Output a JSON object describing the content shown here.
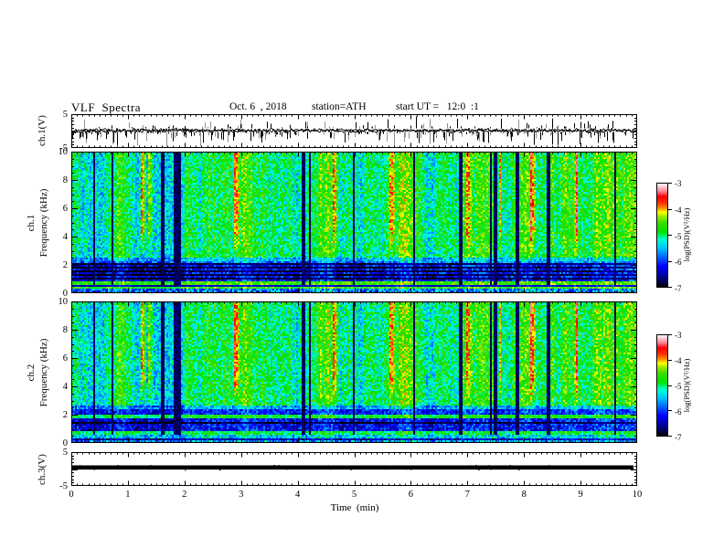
{
  "title": {
    "main": "VLF  Spectra",
    "date": "Oct. 6  , 2018",
    "station": "station=ATH",
    "start_ut": "start UT =   12:0  :1"
  },
  "axes": {
    "x": {
      "label": "Time  (min)",
      "min": 0,
      "max": 10,
      "major_ticks": [
        "0",
        "1",
        "2",
        "3",
        "4",
        "5",
        "6",
        "7",
        "8",
        "9",
        "10"
      ],
      "minor_step_min": 0.1
    },
    "wave1": {
      "ylabel": "ch.1(V)",
      "ticks": [
        "5",
        "-5"
      ],
      "ymin": -5,
      "ymax": 5
    },
    "spec1": {
      "ylabel_channel": "ch.1",
      "ylabel_axis": "Frequency  (kHz)",
      "ticks": [
        "10",
        "8",
        "6",
        "4",
        "2",
        "0"
      ],
      "ymin": 0,
      "ymax": 10
    },
    "spec2": {
      "ylabel_channel": "ch.2",
      "ylabel_axis": "Frequency  (kHz)",
      "ticks": [
        "10",
        "8",
        "6",
        "4",
        "2",
        "0"
      ],
      "ymin": 0,
      "ymax": 10
    },
    "wave3": {
      "ylabel": "ch.3(V)",
      "ticks": [
        "5",
        "-5"
      ],
      "ymin": -5,
      "ymax": 5
    }
  },
  "colorbar": {
    "label": "log(PSD)(V²/Hz)",
    "ticks": [
      "-3",
      "-4",
      "-5",
      "-6",
      "-7"
    ],
    "zmin": -7,
    "zmax": -3,
    "gradient_stops": [
      [
        0.0,
        "#000000"
      ],
      [
        0.09,
        "#000085"
      ],
      [
        0.2,
        "#0000ff"
      ],
      [
        0.3,
        "#0070ff"
      ],
      [
        0.38,
        "#00c8ff"
      ],
      [
        0.46,
        "#00ffd0"
      ],
      [
        0.53,
        "#00e400"
      ],
      [
        0.62,
        "#3cdc00"
      ],
      [
        0.68,
        "#9cec00"
      ],
      [
        0.72,
        "#ffff00"
      ],
      [
        0.76,
        "#ff8c00"
      ],
      [
        0.81,
        "#ff3000"
      ],
      [
        0.87,
        "#f80000"
      ],
      [
        0.92,
        "#ff8090"
      ],
      [
        0.97,
        "#ffd2dc"
      ],
      [
        1.0,
        "#ffffff"
      ]
    ]
  },
  "chart_data": [
    {
      "type": "line",
      "panel": "top-waveform",
      "ylabel": "ch.1(V)",
      "xlim": [
        0,
        10
      ],
      "ylim": [
        -5,
        5
      ],
      "yticks": [
        5,
        -5
      ],
      "description": "Continuous black VLF waveform, mean near 0 V with ~1 V broadband noise and dense impulsive sferic spikes reaching -5 to +5 V across the full 0-10 min record."
    },
    {
      "type": "heatmap",
      "panel": "ch1-spectrogram",
      "ylabel": "ch.1 Frequency (kHz)",
      "xlim": [
        0,
        10
      ],
      "ylim": [
        0,
        10
      ],
      "zlim": [
        -7,
        -3
      ],
      "zlabel": "log(PSD)(V²/Hz)",
      "yticks": [
        0,
        2,
        4,
        6,
        8,
        10
      ],
      "zticks": [
        -3,
        -4,
        -5,
        -6,
        -7
      ],
      "features": [
        "green broadband field near log PSD -5 covering 2.5-10 kHz",
        "dense vertical yellow/orange/red sferic striations spanning 3-10 kHz",
        "about 20 narrow black dropout columns through most of the band",
        "blue low-power region 0.9-2.5 kHz with dark horizontal stripes near 1.1, 1.35, 1.6, 1.85, 2.1 kHz",
        "bright green-yellow band 0.4-0.85 kHz with a dark line near 0.6 kHz",
        "dark speckled strip below 0.35 kHz"
      ]
    },
    {
      "type": "heatmap",
      "panel": "ch2-spectrogram",
      "ylabel": "ch.2 Frequency (kHz)",
      "xlim": [
        0,
        10
      ],
      "ylim": [
        0,
        10
      ],
      "zlim": [
        -7,
        -3
      ],
      "zlabel": "log(PSD)(V²/Hz)",
      "yticks": [
        0,
        2,
        4,
        6,
        8,
        10
      ],
      "zticks": [
        -3,
        -4,
        -5,
        -6,
        -7
      ],
      "features": [
        "green broadband field 2.6-10 kHz with yellow/orange/red striations",
        "black dropout columns at the same times as ch.1",
        "blue low-power region 0.95-2.6 kHz",
        "yellow-green horizontal band near 1.8-2.0 kHz",
        "green band 0.65-0.95 kHz",
        "banded dark/cyan speckle below 0.6 kHz"
      ]
    },
    {
      "type": "line",
      "panel": "bottom-waveform",
      "ylabel": "ch.3(V)",
      "xlim": [
        0,
        10
      ],
      "ylim": [
        -5,
        5
      ],
      "yticks": [
        5,
        -5
      ],
      "description": "Flat thick black trace pinned near +0.4 V for the entire record (dead channel)."
    }
  ]
}
